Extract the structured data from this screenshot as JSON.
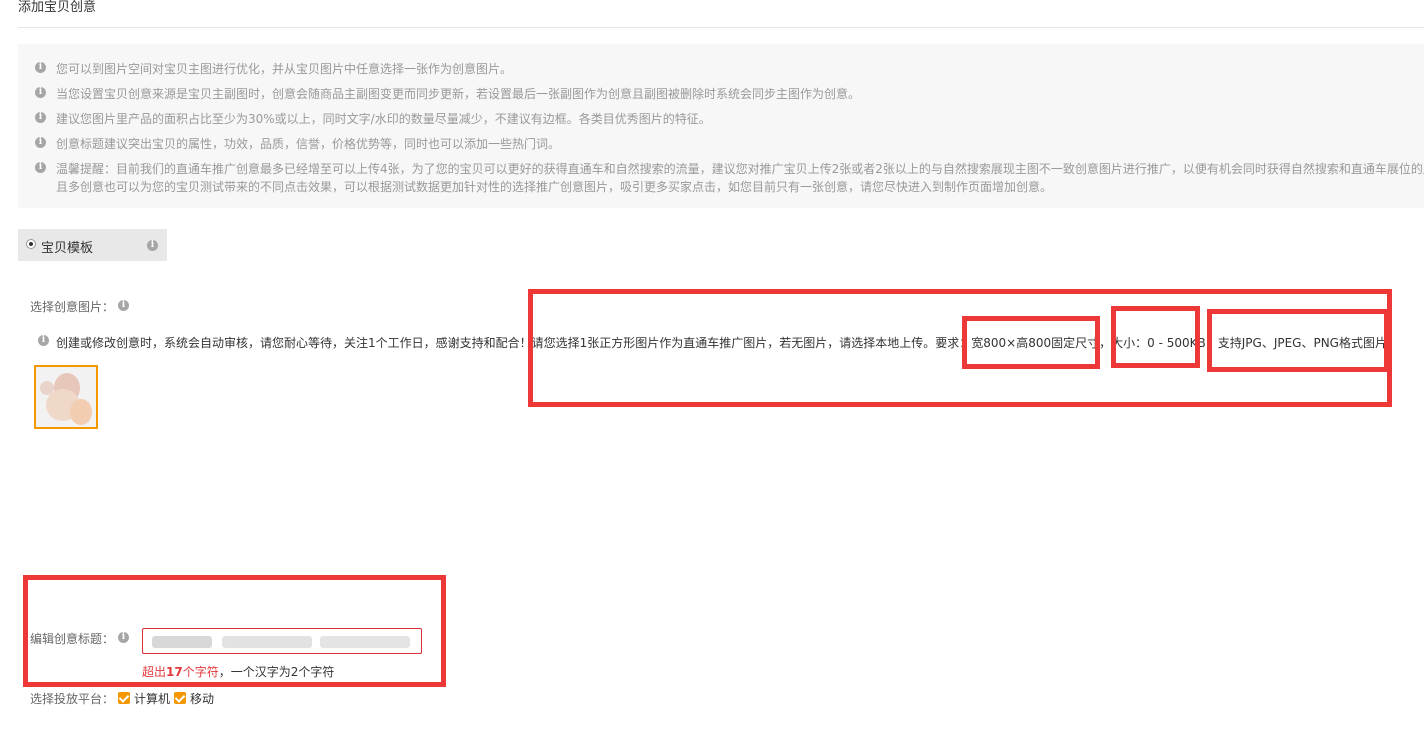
{
  "page": {
    "title": "添加宝贝创意"
  },
  "notices": [
    {
      "text": "您可以到图片空间对宝贝主图进行优化，并从宝贝图片中任意选择一张作为创意图片。"
    },
    {
      "text": "当您设置宝贝创意来源是宝贝主副图时，创意会随商品主副图变更而同步更新，若设置最后一张副图作为创意且副图被删除时系统会同步主图作为创意。"
    },
    {
      "text": "建议您图片里产品的面积占比至少为30%或以上，同时文字/水印的数量尽量减少，不建议有边框。各类目优秀图片的特征。"
    },
    {
      "text": "创意标题建议突出宝贝的属性，功效，品质，信誉，价格优势等，同时也可以添加一些热门词。"
    },
    {
      "text": "温馨提醒：目前我们的直通车推广创意最多已经增至可以上传4张，为了您的宝贝可以更好的获得直通车和自然搜索的流量，建议您对推广宝贝上传2张或者2张以上的与自然搜索展现主图不一致创意图片进行推广，以便有机会同时获得自然搜索和直通车展位的展",
      "text2": "且多创意也可以为您的宝贝测试带来的不同点击效果，可以根据测试数据更加针对性的选择推广创意图片，吸引更多买家点击，如您目前只有一张创意，请您尽快进入到制作页面增加创意。"
    }
  ],
  "template": {
    "label": "宝贝模板"
  },
  "image_section": {
    "label": "选择创意图片：",
    "audit_text": "创建或修改创意时，系统会自动审核，请您耐心等待，关注1个工作日，感谢支持和配合！请您选择1张正方形图片作为直通车推广图片，若无图片，请选择本地上传。要求：宽800×高800固定尺寸，大小：0 - 500KB，支持JPG、JPEG、PNG格式图片。"
  },
  "title_section": {
    "label": "编辑创意标题：",
    "hint_prefix": "超出",
    "hint_count": "17",
    "hint_suffix": "个字符",
    "hint_rest": "，一个汉字为2个字符"
  },
  "platform_section": {
    "label": "选择投放平台：",
    "options": [
      {
        "label": "计算机",
        "checked": true
      },
      {
        "label": "移动",
        "checked": true
      }
    ]
  },
  "colors": {
    "annotation_red": "#ee3838",
    "accent_orange": "#f39800",
    "error_red": "#e4393c"
  },
  "icons": {
    "info": "info-circle-icon",
    "radio": "radio-selected-icon",
    "checkbox": "checkbox-checked-icon"
  }
}
